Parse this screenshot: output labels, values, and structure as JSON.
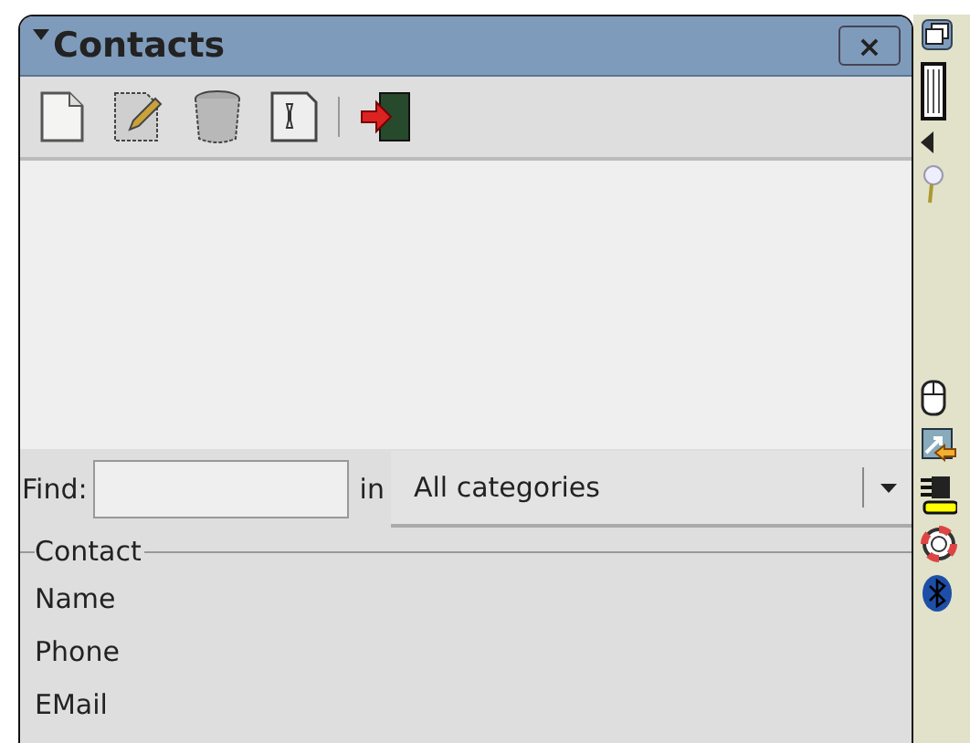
{
  "window": {
    "title": "Contacts",
    "expanded": true,
    "close": "×"
  },
  "toolbar": [
    {
      "kind": "new"
    },
    {
      "kind": "edit"
    },
    {
      "kind": "delete"
    },
    {
      "kind": "settings"
    },
    {
      "kind": "separator"
    },
    {
      "kind": "exit"
    }
  ],
  "search": {
    "label": "Find:",
    "in_label": "in",
    "category": "All categories"
  },
  "contact": {
    "title": "Contact",
    "fields": [
      "Name",
      "Phone",
      "EMail"
    ]
  },
  "tray": [
    {
      "kind": "windows"
    },
    {
      "kind": "keyboard"
    },
    {
      "kind": "arrow"
    },
    {
      "kind": "pin"
    },
    {
      "kind": "spacer"
    },
    {
      "kind": "mouse"
    },
    {
      "kind": "sync"
    },
    {
      "kind": "plug"
    },
    {
      "kind": "help"
    },
    {
      "kind": "bluetooth"
    }
  ]
}
